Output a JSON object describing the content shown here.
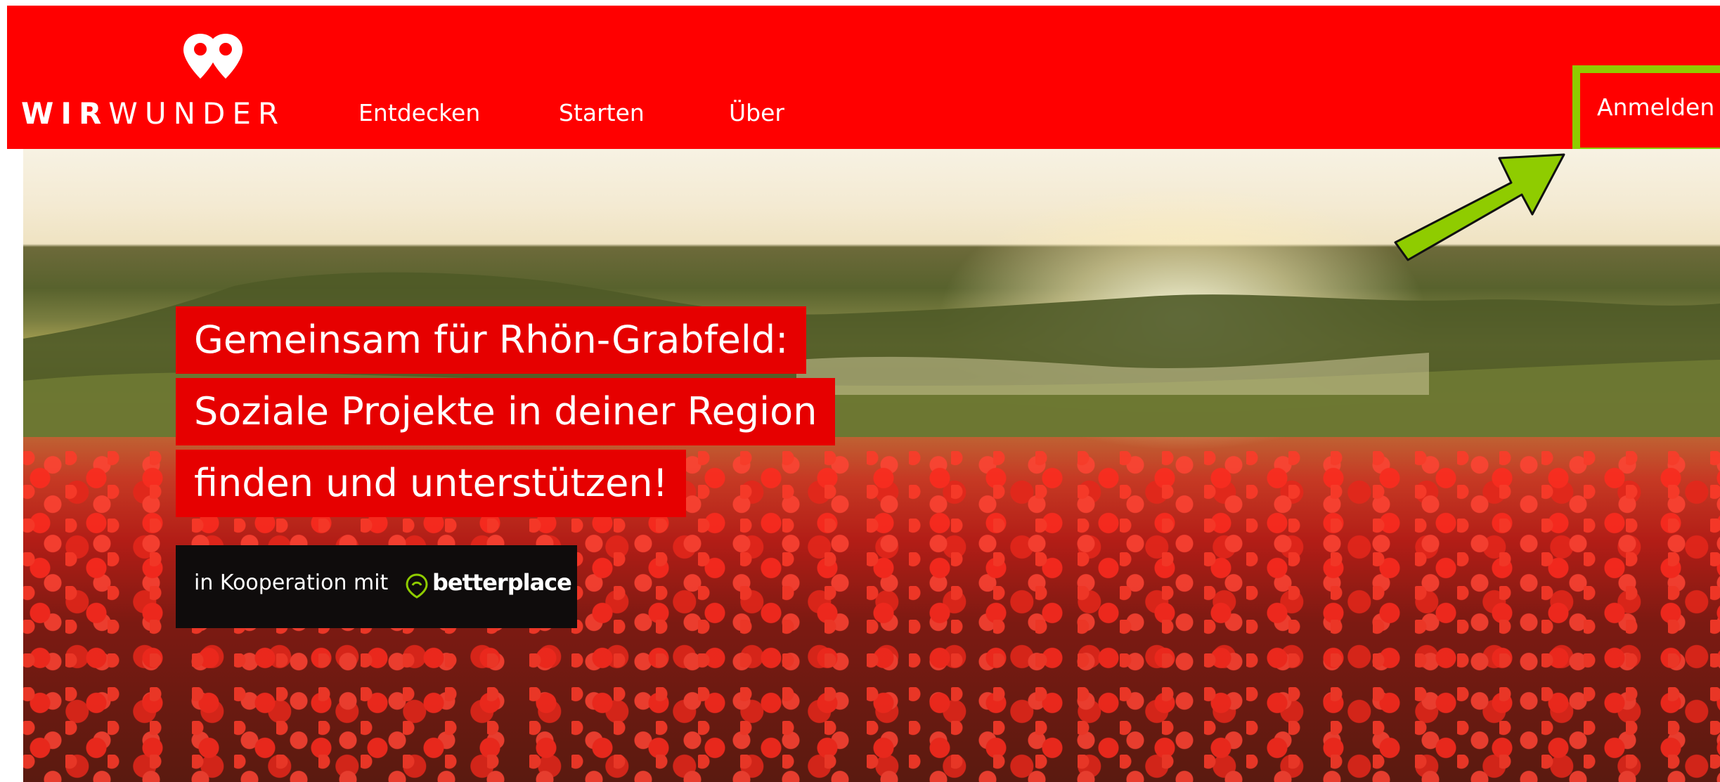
{
  "header": {
    "logo_bold": "WIR",
    "logo_light": "WUNDER",
    "nav": [
      "Entdecken",
      "Starten",
      "Über"
    ],
    "login_label": "Anmelden",
    "highlight_color": "#8fcc00",
    "brand_color": "#ff0000"
  },
  "hero": {
    "headline_lines": [
      "Gemeinsam für Rhön-Grabfeld:",
      "Soziale Projekte in deiner Region",
      "finden und unterstützen!"
    ],
    "coop_text": "in Kooperation mit",
    "partner_name": "betterplace"
  }
}
